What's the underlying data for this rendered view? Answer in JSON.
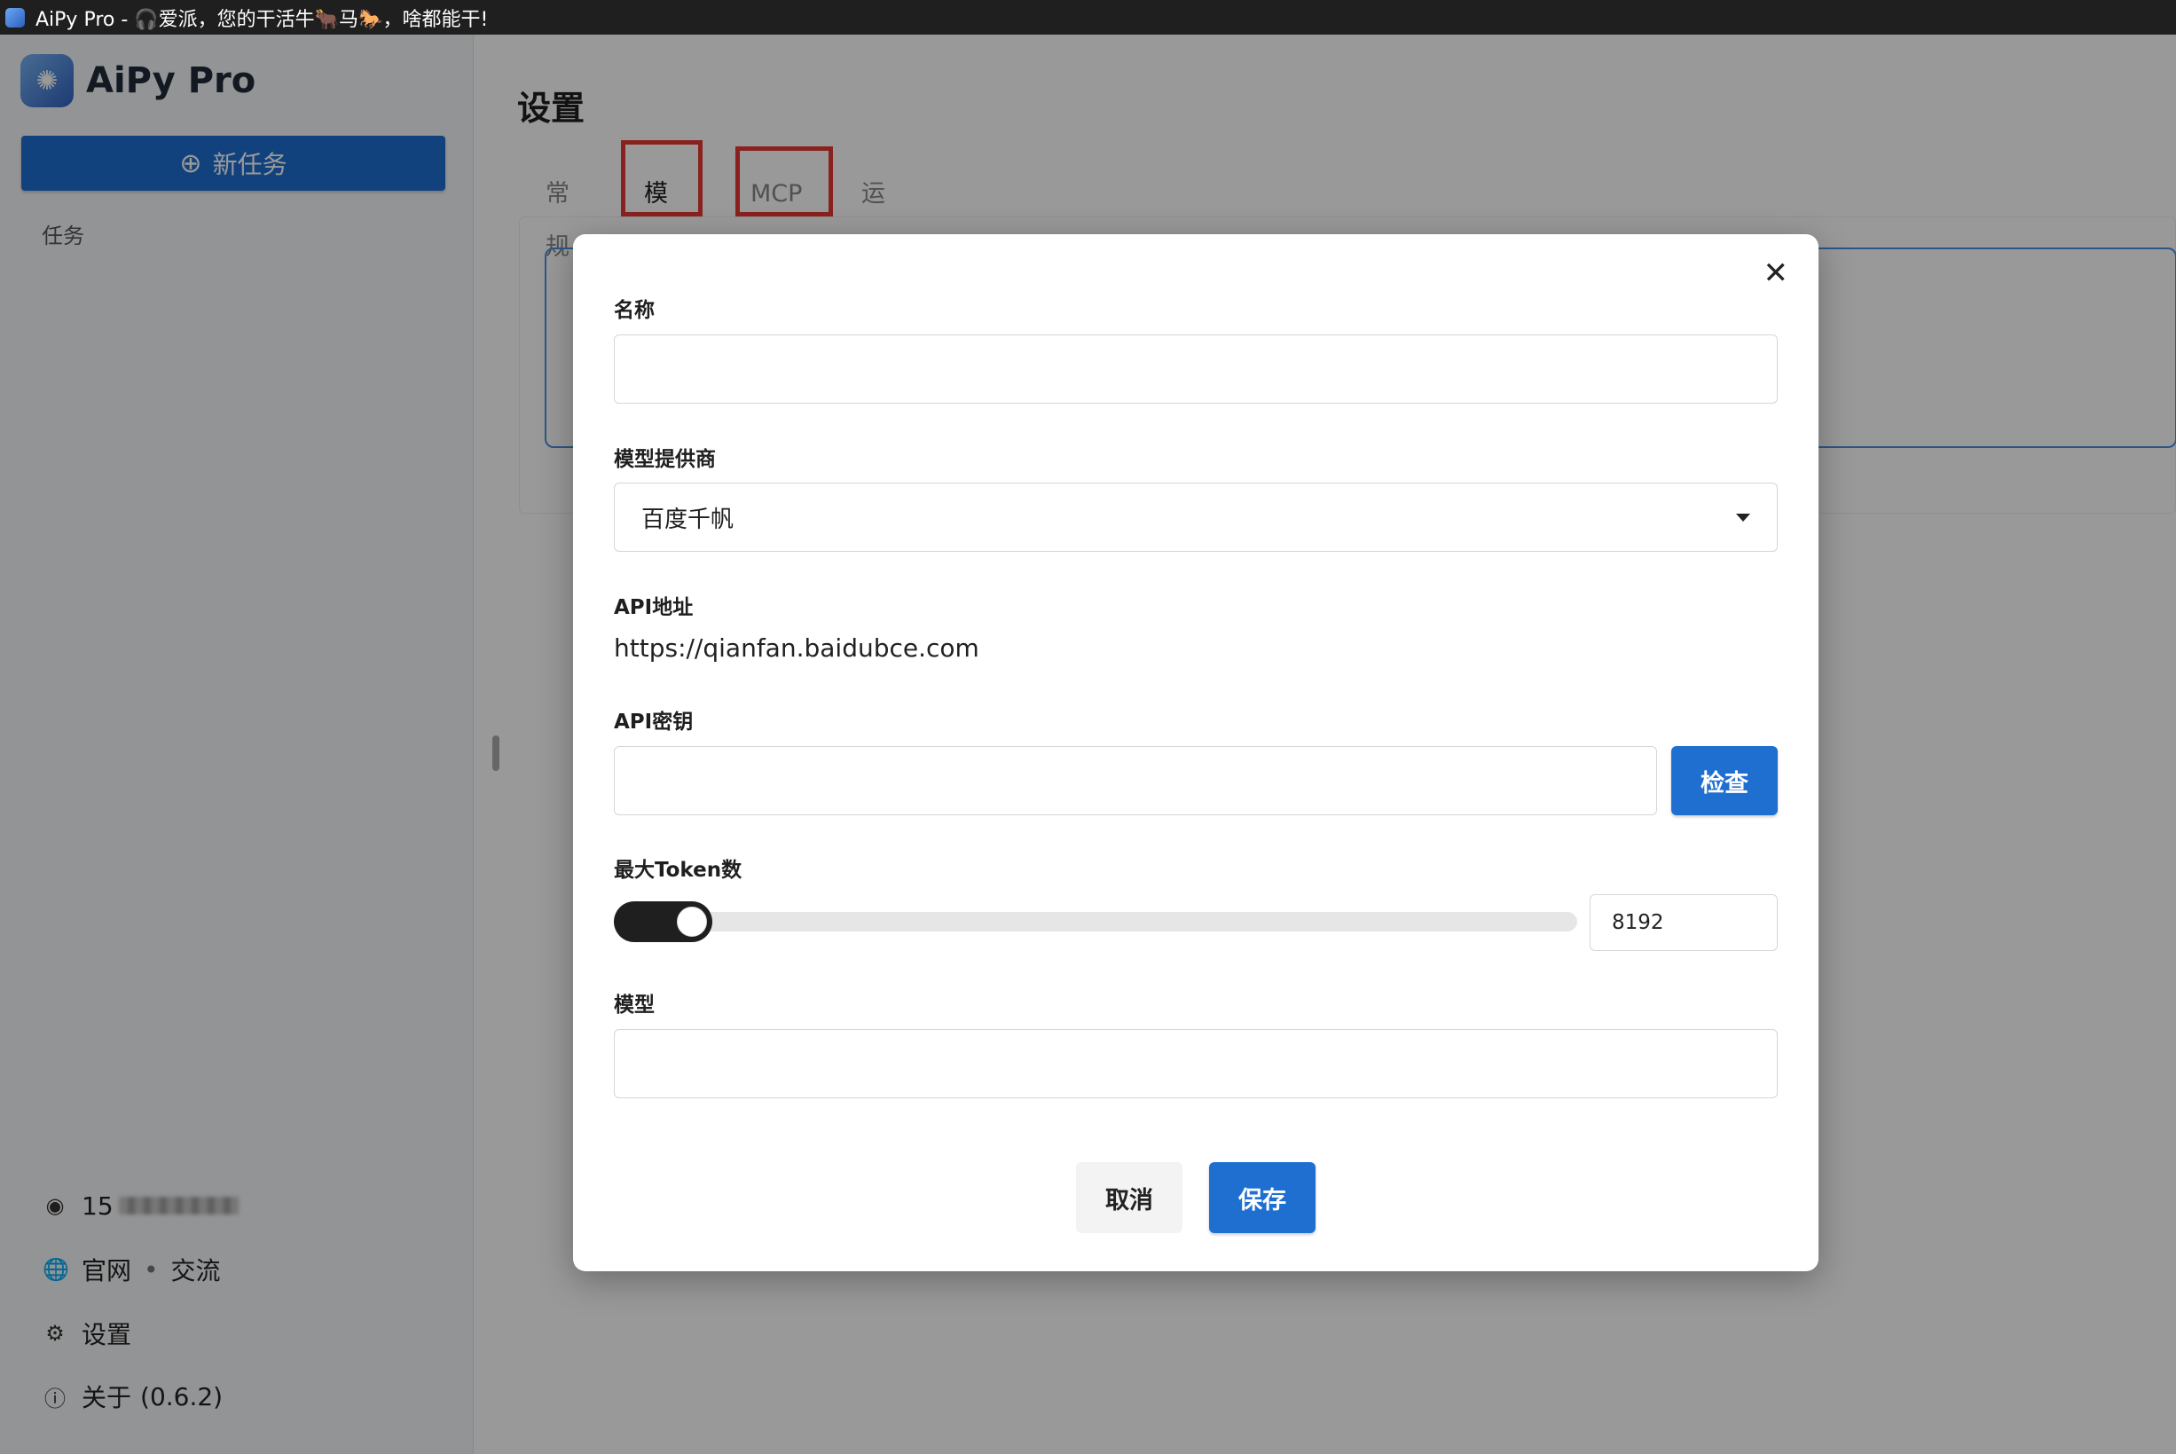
{
  "window": {
    "title": "AiPy Pro - 🎧爱派，您的干活牛🐂马🐎，啥都能干!"
  },
  "sidebar": {
    "logo_text": "AiPy Pro",
    "new_task_label": "新任务",
    "section_label": "任务",
    "footer": {
      "user_id_prefix": "15",
      "site_label": "官网",
      "separator": "•",
      "community_label": "交流",
      "settings_label": "设置",
      "about_label": "关于",
      "version": "(0.6.2)"
    }
  },
  "main": {
    "title": "设置",
    "tabs": [
      {
        "label": "常规",
        "active": false
      },
      {
        "label": "模型",
        "active": true
      },
      {
        "label": "MCP",
        "active": false
      },
      {
        "label": "运行环境",
        "active": false
      }
    ]
  },
  "modal": {
    "name_label": "名称",
    "name_value": "",
    "provider_label": "模型提供商",
    "provider_value": "百度千帆",
    "api_url_label": "API地址",
    "api_url_value": "https://qianfan.baidubce.com",
    "api_key_label": "API密钥",
    "api_key_value": "",
    "check_label": "检查",
    "max_tokens_label": "最大Token数",
    "max_tokens_value": "8192",
    "max_tokens_slider_fraction": 0.065,
    "model_label": "模型",
    "model_value": "",
    "cancel_label": "取消",
    "save_label": "保存"
  },
  "colors": {
    "accent": "#1f6fd1",
    "highlight_box": "#e53935",
    "overlay": "rgba(0,0,0,0.40)"
  }
}
